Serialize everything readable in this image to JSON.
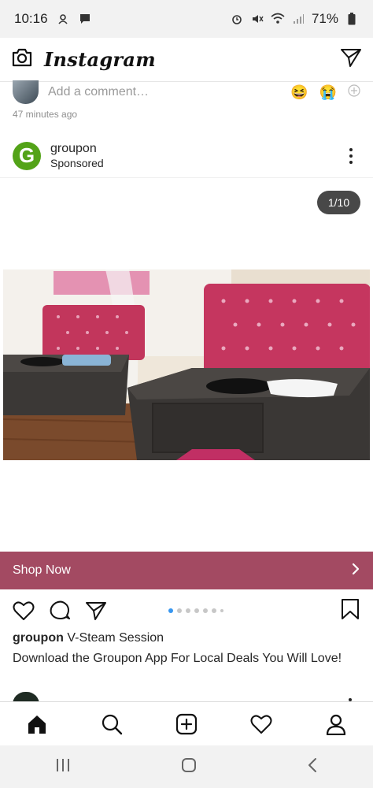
{
  "status_bar": {
    "time": "10:16",
    "battery_percent": "71%"
  },
  "header": {
    "title": "Instagram"
  },
  "comment": {
    "placeholder": "Add a comment…",
    "emojis": [
      "😆",
      "😭"
    ],
    "time_ago": "47 minutes ago"
  },
  "post": {
    "username": "groupon",
    "avatar_letter": "G",
    "sponsored_label": "Sponsored",
    "counter": "1/10",
    "cta_label": "Shop Now",
    "carousel": {
      "current": 1,
      "total": 10,
      "visible_dots": 7
    },
    "caption_user": "groupon",
    "caption_title": "V-Steam Session",
    "caption_body": "Download the Groupon App For Local Deals You Will Love!"
  },
  "colors": {
    "cta_bg": "#a34a62",
    "groupon_green": "#53a318",
    "active_dot": "#3897f0"
  },
  "bottom_nav": [
    "home-icon",
    "search-icon",
    "add-post-icon",
    "activity-heart-icon",
    "profile-icon"
  ],
  "system_nav": [
    "recent-apps-icon",
    "home-circle-icon",
    "back-icon"
  ]
}
